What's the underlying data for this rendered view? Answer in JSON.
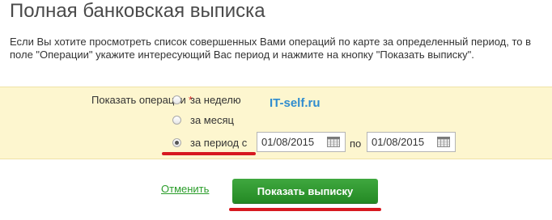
{
  "page": {
    "title": "Полная банковская выписка",
    "description": "Если Вы хотите просмотреть список совершенных Вами операций по карте за определенный период, то в поле \"Операции\" укажите интересующий Вас период и нажмите на кнопку \"Показать выписку\"."
  },
  "form": {
    "label": "Показать операции",
    "required_mark": "*",
    "options": [
      {
        "label": "за неделю",
        "checked": false
      },
      {
        "label": "за месяц",
        "checked": false
      },
      {
        "label": "за период с",
        "checked": true
      }
    ],
    "date_from": "01/08/2015",
    "date_separator": "по",
    "date_to": "01/08/2015"
  },
  "watermark": "IT-self.ru",
  "actions": {
    "cancel_label": "Отменить",
    "submit_label": "Показать выписку"
  },
  "colors": {
    "panel_bg": "#fdf6cf",
    "button": "#2e9b2e",
    "link": "#2a9d2a",
    "highlight_underline": "#d71920",
    "watermark": "#2f8ccf"
  }
}
